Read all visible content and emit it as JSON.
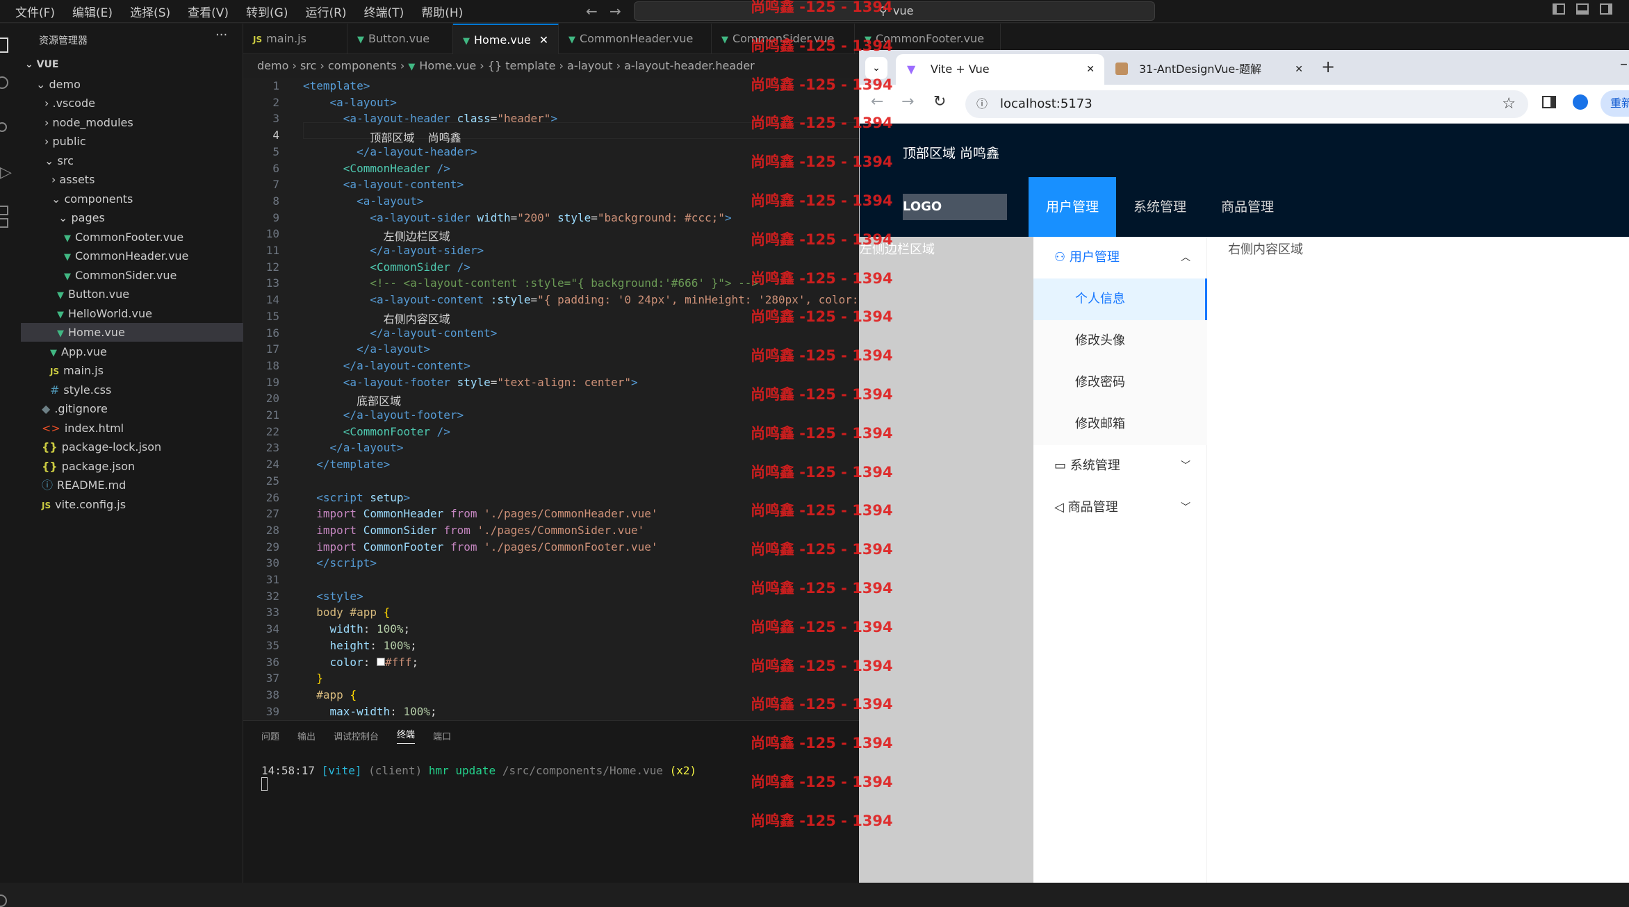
{
  "menubar": [
    "文件(F)",
    "编辑(E)",
    "选择(S)",
    "查看(V)",
    "转到(G)",
    "运行(R)",
    "终端(T)",
    "帮助(H)"
  ],
  "command_center": "vue",
  "explorer": {
    "title": "资源管理器",
    "root": "VUE",
    "items": [
      "demo",
      ".vscode",
      "node_modules",
      "public",
      "src",
      "assets",
      "components",
      "pages",
      "CommonFooter.vue",
      "CommonHeader.vue",
      "CommonSider.vue",
      "Button.vue",
      "HelloWorld.vue",
      "Home.vue",
      "App.vue",
      "main.js",
      "style.css",
      ".gitignore",
      "index.html",
      "package-lock.json",
      "package.json",
      "README.md",
      "vite.config.js"
    ]
  },
  "editor_tabs": [
    "main.js",
    "Button.vue",
    "Home.vue",
    "CommonHeader.vue",
    "CommonSider.vue",
    "CommonFooter.vue"
  ],
  "breadcrumb": [
    "demo",
    "src",
    "components",
    "Home.vue",
    "{} template",
    "a-layout",
    "a-layout-header.header"
  ],
  "panel_tabs": [
    "问题",
    "输出",
    "调试控制台",
    "终端",
    "端口"
  ],
  "terminal": {
    "time": "14:58:17",
    "tag": "[vite]",
    "client": "(client)",
    "msg": "hmr update",
    "path": "/src/components/Home.vue",
    "count": "(x2)"
  },
  "watermark": "尚鸣鑫 -125 - 1394",
  "browser": {
    "tabs": [
      "Vite + Vue",
      "31-AntDesignVue-题解"
    ],
    "url": "localhost:5173",
    "header_text": "顶部区域 尚鸣鑫",
    "logo": "LOGO",
    "top_menu": [
      "用户管理",
      "系统管理",
      "商品管理"
    ],
    "left_sider_text": "左侧边栏区域",
    "side_menu": [
      "用户管理",
      "个人信息",
      "修改头像",
      "修改密码",
      "修改邮箱",
      "系统管理",
      "商品管理"
    ],
    "content_text": "右侧内容区域",
    "restart": "重新"
  }
}
